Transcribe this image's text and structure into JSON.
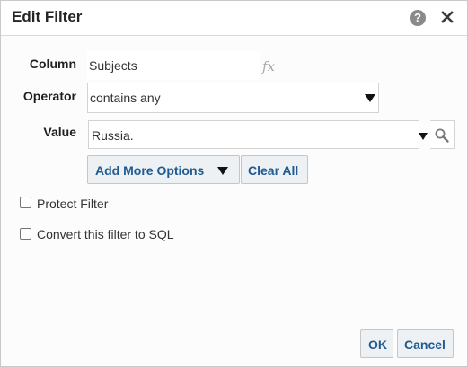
{
  "dialog": {
    "title": "Edit Filter",
    "help_glyph": "?",
    "help_icon": "question-circle-icon",
    "close_icon": "close-x-icon"
  },
  "form": {
    "column_label": "Column",
    "column_value": "Subjects",
    "fx_glyph": "fx",
    "operator_label": "Operator",
    "operator_value": "contains any",
    "value_label": "Value",
    "value_text": "Russia.",
    "search_icon": "magnifier-icon"
  },
  "buttons": {
    "add_more_options": "Add More Options",
    "clear_all": "Clear All",
    "ok": "OK",
    "cancel": "Cancel"
  },
  "options": {
    "protect_filter": {
      "label": "Protect Filter",
      "checked": false
    },
    "convert_to_sql": {
      "label": "Convert this filter to SQL",
      "checked": false
    }
  },
  "colors": {
    "button_text": "#1f5a91",
    "button_bg": "#eef1f3",
    "help_icon": "#8a8a8a"
  }
}
